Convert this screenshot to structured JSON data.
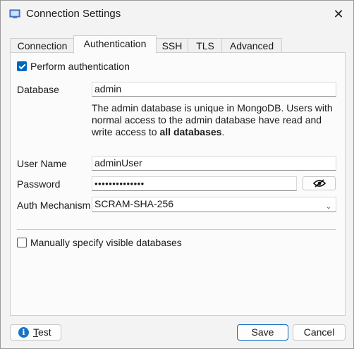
{
  "window": {
    "title": "Connection Settings",
    "close_glyph": "✕",
    "app_icon": "window-icon"
  },
  "tabs": [
    {
      "label": "Connection",
      "active": false
    },
    {
      "label": "Authentication",
      "active": true
    },
    {
      "label": "SSH",
      "active": false
    },
    {
      "label": "TLS",
      "active": false
    },
    {
      "label": "Advanced",
      "active": false
    }
  ],
  "auth": {
    "perform_label": "Perform authentication",
    "perform_checked": true,
    "database_label": "Database",
    "database_value": "admin",
    "note_part1": "The admin database is unique in MongoDB. Users with normal access to the admin database have read and write access to ",
    "note_bold": "all databases",
    "note_end": ".",
    "username_label": "User Name",
    "username_value": "adminUser",
    "password_label": "Password",
    "password_value": "••••••••••••••",
    "show_password_icon": "eye-icon",
    "mechanism_label": "Auth Mechanism",
    "mechanism_value": "SCRAM-SHA-256",
    "manual_db_label": "Manually specify visible databases",
    "manual_db_checked": false
  },
  "footer": {
    "test_label_first": "T",
    "test_label_rest": "est",
    "test_icon": "info-icon",
    "save_label": "Save",
    "cancel_label": "Cancel"
  },
  "colors": {
    "accent": "#0067c0",
    "info": "#1a73c7",
    "background": "#f3f3f3",
    "panel": "#fbfbfb"
  }
}
